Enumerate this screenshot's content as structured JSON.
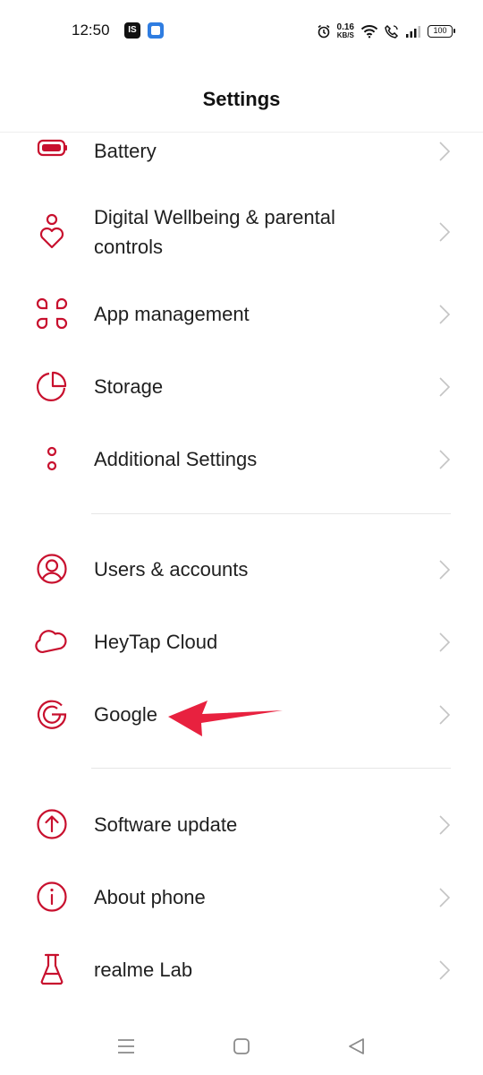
{
  "status_bar": {
    "time": "12:50",
    "app1_badge": "IS",
    "net_speed": "0.16",
    "net_unit": "KB/S",
    "battery": "100"
  },
  "header": {
    "title": "Settings"
  },
  "accent_color": "#c8102e",
  "sections": [
    {
      "items": [
        {
          "label": "Battery",
          "icon": "battery-icon"
        },
        {
          "label": "Digital Wellbeing & parental controls",
          "icon": "wellbeing-heart-icon"
        },
        {
          "label": "App management",
          "icon": "app-grid-icon"
        },
        {
          "label": "Storage",
          "icon": "pie-chart-icon"
        },
        {
          "label": "Additional Settings",
          "icon": "dots-icon"
        }
      ]
    },
    {
      "items": [
        {
          "label": "Users & accounts",
          "icon": "user-circle-icon"
        },
        {
          "label": "HeyTap Cloud",
          "icon": "cloud-icon"
        },
        {
          "label": "Google",
          "icon": "google-g-icon"
        }
      ]
    },
    {
      "items": [
        {
          "label": "Software update",
          "icon": "arrow-up-circle-icon"
        },
        {
          "label": "About phone",
          "icon": "info-circle-icon"
        },
        {
          "label": "realme Lab",
          "icon": "flask-icon"
        }
      ]
    }
  ],
  "annotation": {
    "color": "#e8213f",
    "points_to": "Google"
  }
}
